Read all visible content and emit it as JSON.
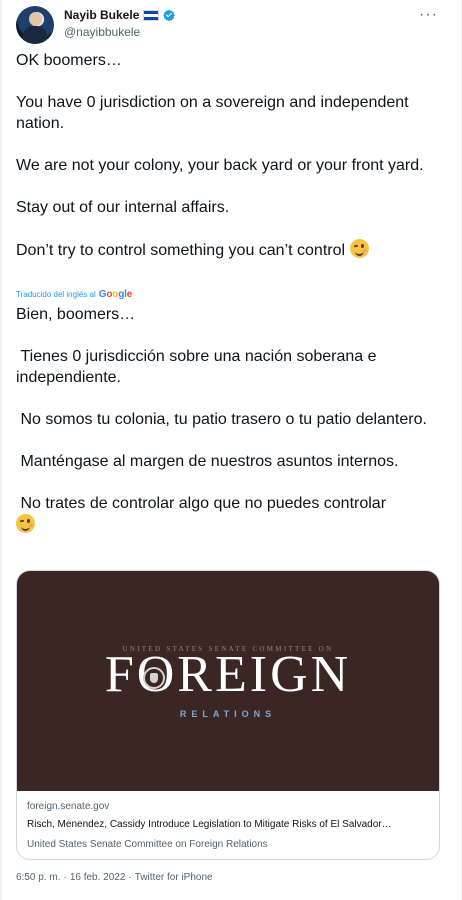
{
  "author": {
    "name": "Nayib Bukele",
    "handle": "@nayibbukele",
    "more_label": "···"
  },
  "tweet": {
    "paragraphs": [
      "OK boomers…",
      "You have 0 jurisdiction on a sovereign and independent nation.",
      "We are not your colony, your back yard or your front yard.",
      "Stay out of our internal affairs.",
      "Don’t try to control something you can’t control"
    ]
  },
  "translation": {
    "attribution": "Traducido del inglés al",
    "provider": "Google",
    "paragraphs": [
      "Bien, boomers…",
      " Tienes 0 jurisdicción sobre una nación soberana e independiente.",
      " No somos tu colonia, tu patio trasero o tu patio delantero.",
      " Manténgase al margen de nuestros asuntos internos.",
      " No trates de controlar algo que no puedes controlar"
    ]
  },
  "card": {
    "image": {
      "committee_line": "UNITED STATES SENATE COMMITTEE ON",
      "word": "FOREIGN",
      "sub": "RELATIONS"
    },
    "domain": "foreign.senate.gov",
    "title": "Risch, Menendez, Cassidy Introduce Legislation to Mitigate Risks of El Salvador…",
    "description": "United States Senate Committee on Foreign Relations"
  },
  "meta": {
    "time": "6:50 p. m.",
    "date": "16 feb. 2022",
    "separator": "·",
    "source": "Twitter for iPhone"
  },
  "emoji_name": "winking-face-emoji",
  "colors": {
    "link": "#1d9bf0",
    "text": "#0f1419",
    "secondary": "#536471",
    "card_bg": "#3a2723"
  }
}
